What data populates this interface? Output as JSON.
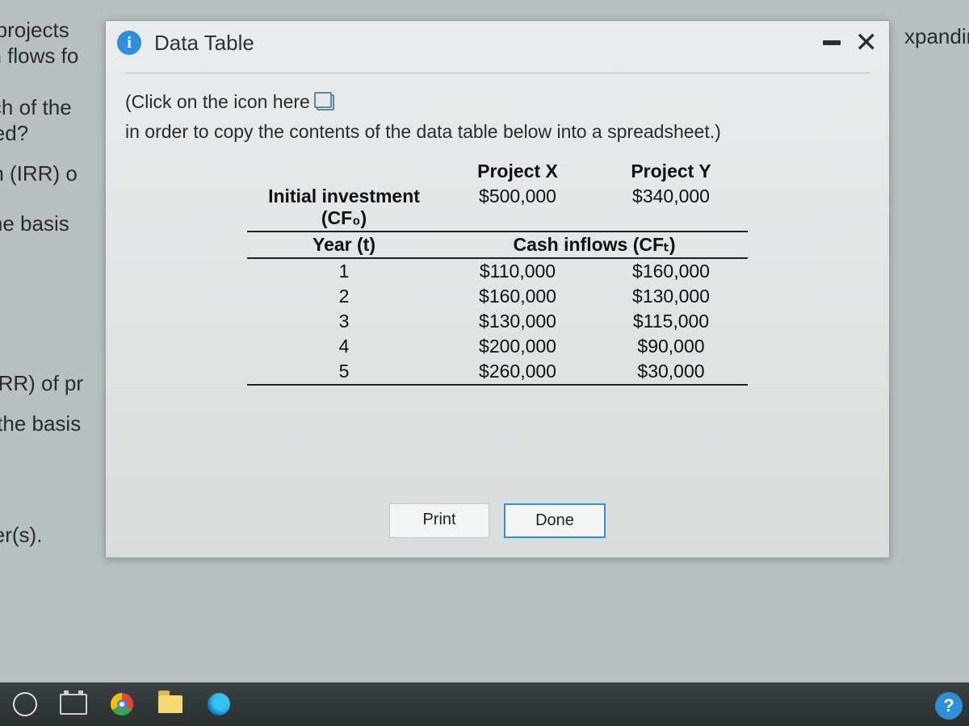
{
  "dialog": {
    "title": "Data Table",
    "info_symbol": "i",
    "instruction_pre": "(Click on the icon here",
    "instruction_post": "in order to copy the contents of the data table below into a spreadsheet.)",
    "print_label": "Print",
    "done_label": "Done"
  },
  "table": {
    "col_headers": [
      "",
      "Project X",
      "Project Y"
    ],
    "initial_label_line1": "Initial investment",
    "initial_label_line2": "(CF₀)",
    "initial_values": [
      "$500,000",
      "$340,000"
    ],
    "year_label": "Year (t)",
    "cash_inflows_label": "Cash inflows (CFₜ)",
    "rows": [
      {
        "year": "1",
        "x": "$110,000",
        "y": "$160,000"
      },
      {
        "year": "2",
        "x": "$160,000",
        "y": "$130,000"
      },
      {
        "year": "3",
        "x": "$130,000",
        "y": "$115,000"
      },
      {
        "year": "4",
        "x": "$200,000",
        "y": "$90,000"
      },
      {
        "year": "5",
        "x": "$260,000",
        "y": "$30,000"
      }
    ]
  },
  "bg": {
    "l1": "ve projects",
    "l2": "ash flows fo",
    "l3": "each of the",
    "l4": "erred?",
    "l5": "turn (IRR) o",
    "l6": "n the basis",
    "l7": "n (IRR) of pr",
    "l8": "on the basis",
    "l9": "swer(s).",
    "r1": "xpanding t"
  },
  "help": "?"
}
